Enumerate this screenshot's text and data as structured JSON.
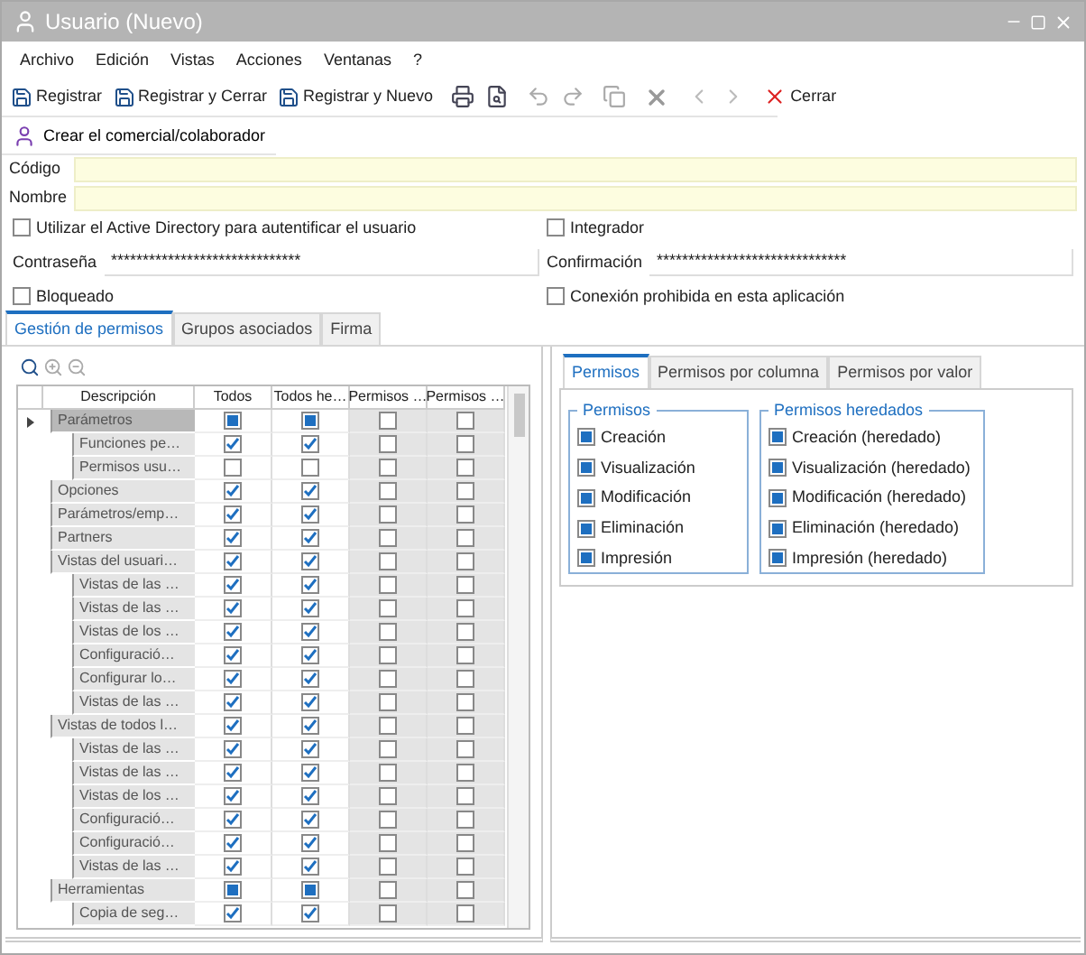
{
  "window": {
    "title": "Usuario (Nuevo)"
  },
  "menu": [
    "Archivo",
    "Edición",
    "Vistas",
    "Acciones",
    "Ventanas",
    "?"
  ],
  "toolbar": [
    {
      "kind": "save",
      "label": "Registrar"
    },
    {
      "kind": "save-close",
      "label": "Registrar y Cerrar"
    },
    {
      "kind": "save-new",
      "label": "Registrar y Nuevo"
    },
    {
      "kind": "sep"
    },
    {
      "kind": "print"
    },
    {
      "kind": "preview"
    },
    {
      "kind": "sep"
    },
    {
      "kind": "undo"
    },
    {
      "kind": "redo"
    },
    {
      "kind": "sep"
    },
    {
      "kind": "copy"
    },
    {
      "kind": "sep"
    },
    {
      "kind": "delete"
    },
    {
      "kind": "sep"
    },
    {
      "kind": "prev"
    },
    {
      "kind": "next"
    },
    {
      "kind": "sep"
    },
    {
      "kind": "close",
      "label": "Cerrar"
    }
  ],
  "create_button": "Crear el comercial/colaborador",
  "fields": [
    {
      "label": "Código"
    },
    {
      "label": "Nombre"
    }
  ],
  "options": [
    {
      "label": "Utilizar el Active Directory para autentificar el usuario",
      "checked": false
    },
    {
      "label": "Integrador",
      "checked": false
    }
  ],
  "passwords": [
    {
      "label": "Contraseña",
      "value": "******************************"
    },
    {
      "label": "Confirmación",
      "value": "******************************"
    }
  ],
  "options2": [
    {
      "label": "Bloqueado",
      "checked": false
    },
    {
      "label": "Conexión prohibida en esta aplicación",
      "checked": false
    }
  ],
  "tabs": [
    {
      "label": "Gestión de permisos",
      "selected": true
    },
    {
      "label": "Grupos asociados",
      "selected": false
    },
    {
      "label": "Firma",
      "selected": false
    }
  ],
  "grid": {
    "columns": [
      "Descripción",
      "Todos",
      "Todos he…",
      "Permisos …",
      "Permisos …"
    ],
    "rows": [
      {
        "label": "Parámetros",
        "selected": true,
        "cells": [
          {
            "kind": "indeterminate"
          },
          {
            "kind": "indeterminate"
          },
          {
            "kind": "unchecked"
          },
          {
            "kind": "unchecked"
          }
        ],
        "children": [
          {
            "label": "Funciones pe…",
            "selected": false,
            "cells": [
              {
                "kind": "checked"
              },
              {
                "kind": "checked"
              },
              {
                "kind": "unchecked"
              },
              {
                "kind": "unchecked"
              }
            ]
          },
          {
            "label": "Permisos usu…",
            "selected": false,
            "cells": [
              {
                "kind": "unchecked"
              },
              {
                "kind": "unchecked"
              },
              {
                "kind": "unchecked"
              },
              {
                "kind": "unchecked"
              }
            ]
          }
        ]
      },
      {
        "label": "Opciones",
        "selected": false,
        "cells": [
          {
            "kind": "checked"
          },
          {
            "kind": "checked"
          },
          {
            "kind": "unchecked"
          },
          {
            "kind": "unchecked"
          }
        ]
      },
      {
        "label": "Parámetros/emp…",
        "selected": false,
        "cells": [
          {
            "kind": "checked"
          },
          {
            "kind": "checked"
          },
          {
            "kind": "unchecked"
          },
          {
            "kind": "unchecked"
          }
        ]
      },
      {
        "label": "Partners",
        "selected": false,
        "cells": [
          {
            "kind": "checked"
          },
          {
            "kind": "checked"
          },
          {
            "kind": "unchecked"
          },
          {
            "kind": "unchecked"
          }
        ]
      },
      {
        "label": "Vistas del usuari…",
        "selected": false,
        "cells": [
          {
            "kind": "checked"
          },
          {
            "kind": "checked"
          },
          {
            "kind": "unchecked"
          },
          {
            "kind": "unchecked"
          }
        ],
        "children": [
          {
            "label": "Vistas de las …",
            "selected": false,
            "cells": [
              {
                "kind": "checked"
              },
              {
                "kind": "checked"
              },
              {
                "kind": "unchecked"
              },
              {
                "kind": "unchecked"
              }
            ]
          },
          {
            "label": "Vistas de las …",
            "selected": false,
            "cells": [
              {
                "kind": "checked"
              },
              {
                "kind": "checked"
              },
              {
                "kind": "unchecked"
              },
              {
                "kind": "unchecked"
              }
            ]
          },
          {
            "label": "Vistas de los …",
            "selected": false,
            "cells": [
              {
                "kind": "checked"
              },
              {
                "kind": "checked"
              },
              {
                "kind": "unchecked"
              },
              {
                "kind": "unchecked"
              }
            ]
          },
          {
            "label": "Configuració…",
            "selected": false,
            "cells": [
              {
                "kind": "checked"
              },
              {
                "kind": "checked"
              },
              {
                "kind": "unchecked"
              },
              {
                "kind": "unchecked"
              }
            ]
          },
          {
            "label": "Configurar lo…",
            "selected": false,
            "cells": [
              {
                "kind": "checked"
              },
              {
                "kind": "checked"
              },
              {
                "kind": "unchecked"
              },
              {
                "kind": "unchecked"
              }
            ]
          },
          {
            "label": "Vistas de las …",
            "selected": false,
            "cells": [
              {
                "kind": "checked"
              },
              {
                "kind": "checked"
              },
              {
                "kind": "unchecked"
              },
              {
                "kind": "unchecked"
              }
            ]
          }
        ]
      },
      {
        "label": "Vistas de todos l…",
        "selected": false,
        "cells": [
          {
            "kind": "checked"
          },
          {
            "kind": "checked"
          },
          {
            "kind": "unchecked"
          },
          {
            "kind": "unchecked"
          }
        ],
        "children": [
          {
            "label": "Vistas de las …",
            "selected": false,
            "cells": [
              {
                "kind": "checked"
              },
              {
                "kind": "checked"
              },
              {
                "kind": "unchecked"
              },
              {
                "kind": "unchecked"
              }
            ]
          },
          {
            "label": "Vistas de las …",
            "selected": false,
            "cells": [
              {
                "kind": "checked"
              },
              {
                "kind": "checked"
              },
              {
                "kind": "unchecked"
              },
              {
                "kind": "unchecked"
              }
            ]
          },
          {
            "label": "Vistas de los …",
            "selected": false,
            "cells": [
              {
                "kind": "checked"
              },
              {
                "kind": "checked"
              },
              {
                "kind": "unchecked"
              },
              {
                "kind": "unchecked"
              }
            ]
          },
          {
            "label": "Configuració…",
            "selected": false,
            "cells": [
              {
                "kind": "checked"
              },
              {
                "kind": "checked"
              },
              {
                "kind": "unchecked"
              },
              {
                "kind": "unchecked"
              }
            ]
          },
          {
            "label": "Configuració…",
            "selected": false,
            "cells": [
              {
                "kind": "checked"
              },
              {
                "kind": "checked"
              },
              {
                "kind": "unchecked"
              },
              {
                "kind": "unchecked"
              }
            ]
          },
          {
            "label": "Vistas de las …",
            "selected": false,
            "cells": [
              {
                "kind": "checked"
              },
              {
                "kind": "checked"
              },
              {
                "kind": "unchecked"
              },
              {
                "kind": "unchecked"
              }
            ]
          }
        ]
      },
      {
        "label": "Herramientas",
        "selected": false,
        "cells": [
          {
            "kind": "indeterminate"
          },
          {
            "kind": "indeterminate"
          },
          {
            "kind": "unchecked"
          },
          {
            "kind": "unchecked"
          }
        ],
        "children": [
          {
            "label": "Copia de seg…",
            "selected": false,
            "cells": [
              {
                "kind": "checked"
              },
              {
                "kind": "checked"
              },
              {
                "kind": "unchecked"
              },
              {
                "kind": "unchecked"
              }
            ]
          }
        ]
      }
    ]
  },
  "right_tabs": [
    {
      "label": "Permisos",
      "selected": true
    },
    {
      "label": "Permisos por columna",
      "selected": false
    },
    {
      "label": "Permisos por valor",
      "selected": false
    }
  ],
  "groups": [
    {
      "title": "Permisos",
      "items": [
        {
          "label": "Creación",
          "kind": "indeterminate"
        },
        {
          "label": "Visualización",
          "kind": "indeterminate"
        },
        {
          "label": "Modificación",
          "kind": "indeterminate"
        },
        {
          "label": "Eliminación",
          "kind": "indeterminate"
        },
        {
          "label": "Impresión",
          "kind": "indeterminate"
        }
      ]
    },
    {
      "title": "Permisos heredados",
      "items": [
        {
          "label": "Creación (heredado)",
          "kind": "indeterminate"
        },
        {
          "label": "Visualización (heredado)",
          "kind": "indeterminate"
        },
        {
          "label": "Modificación (heredado)",
          "kind": "indeterminate"
        },
        {
          "label": "Eliminación (heredado)",
          "kind": "indeterminate"
        },
        {
          "label": "Impresión (heredado)",
          "kind": "indeterminate"
        }
      ]
    }
  ]
}
